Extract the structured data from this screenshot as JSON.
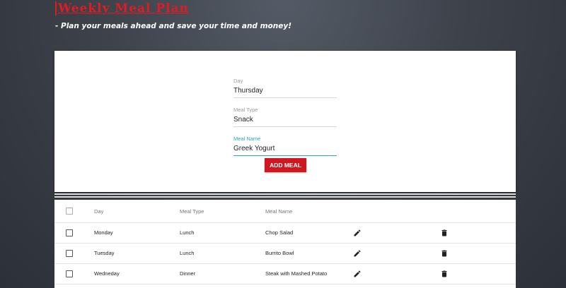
{
  "header": {
    "title": "Weekly Meal Plan",
    "subtitle": "- Plan your meals ahead and save your time and money!"
  },
  "form": {
    "day": {
      "label": "Day",
      "value": "Thursday"
    },
    "meal_type": {
      "label": "Meal Type",
      "value": "Snack"
    },
    "meal_name": {
      "label": "Meal Name",
      "value": "Greek Yogurt"
    },
    "add_button": "ADD MEAL"
  },
  "table": {
    "columns": {
      "day": "Day",
      "meal_type": "Meal Type",
      "meal_name": "Meal Name"
    },
    "rows": [
      {
        "day": "Monday",
        "meal_type": "Lunch",
        "meal_name": "Chop Salad"
      },
      {
        "day": "Tuesday",
        "meal_type": "Lunch",
        "meal_name": "Burrito Bowl"
      },
      {
        "day": "Wedneday",
        "meal_type": "Dinner",
        "meal_name": "Steak with Mashed Potato"
      }
    ]
  },
  "icons": {
    "edit": "pencil-icon",
    "delete": "trash-icon"
  },
  "colors": {
    "accent": "#d0161e",
    "focus": "#2aa7b5",
    "title": "#e01b24"
  }
}
